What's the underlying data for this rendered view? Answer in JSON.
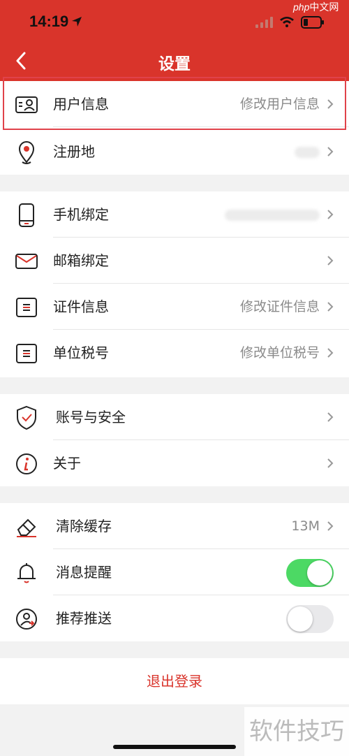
{
  "status_bar": {
    "time": "14:19"
  },
  "watermark_top": {
    "php": "php",
    "text": "中文网"
  },
  "header": {
    "title": "设置"
  },
  "group1": [
    {
      "label": "用户信息",
      "value": "修改用户信息"
    },
    {
      "label": "注册地",
      "value": ""
    }
  ],
  "group2": [
    {
      "label": "手机绑定",
      "value": ""
    },
    {
      "label": "邮箱绑定",
      "value": ""
    },
    {
      "label": "证件信息",
      "value": "修改证件信息"
    },
    {
      "label": "单位税号",
      "value": "修改单位税号"
    }
  ],
  "group3": [
    {
      "label": "账号与安全"
    },
    {
      "label": "关于"
    }
  ],
  "group4": [
    {
      "label": "清除缓存",
      "value": "13M"
    },
    {
      "label": "消息提醒",
      "toggle": "on"
    },
    {
      "label": "推荐推送",
      "toggle": "off"
    }
  ],
  "logout_label": "退出登录",
  "watermark_bottom": "软件技巧",
  "colors": {
    "brand_red": "#d9342b",
    "toggle_on": "#4cd964"
  }
}
